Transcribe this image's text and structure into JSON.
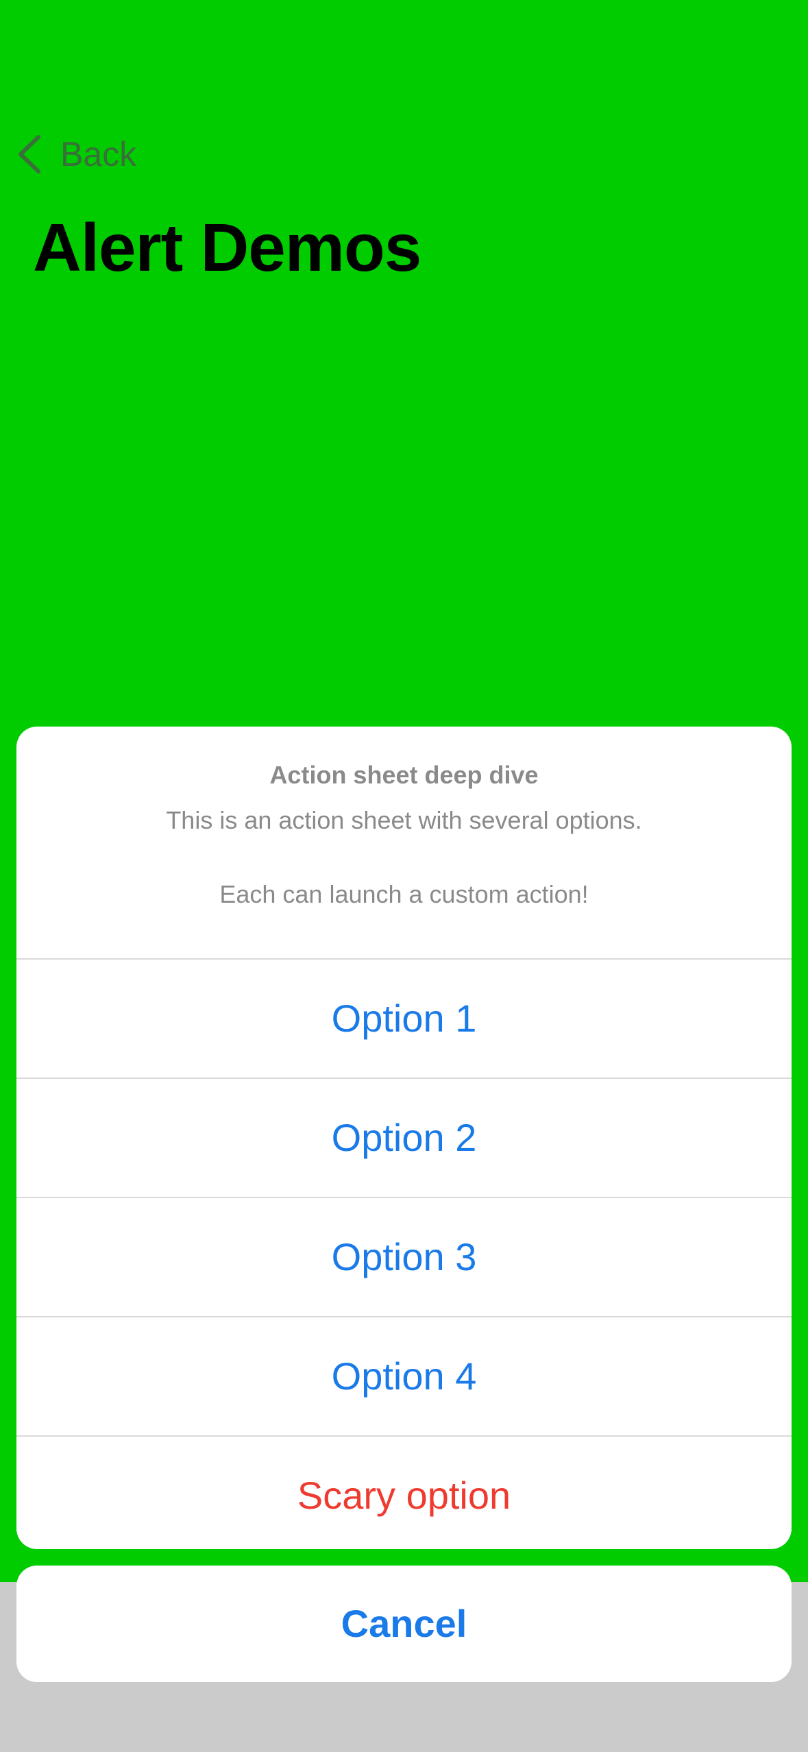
{
  "nav": {
    "back_label": "Back",
    "title": "Alert Demos"
  },
  "action_sheet": {
    "title": "Action sheet deep dive",
    "message_line1": "This is an action sheet with several options.",
    "message_line2": "Each can launch a custom action!",
    "options": [
      {
        "label": "Option 1",
        "style": "default"
      },
      {
        "label": "Option 2",
        "style": "default"
      },
      {
        "label": "Option 3",
        "style": "default"
      },
      {
        "label": "Option 4",
        "style": "default"
      },
      {
        "label": "Scary option",
        "style": "destructive"
      }
    ],
    "cancel_label": "Cancel"
  },
  "colors": {
    "background": "#00cc00",
    "accent": "#1a7ae8",
    "destructive": "#ee3b30",
    "dim_overlay": "#cbcbcb"
  },
  "icons": {
    "back": "chevron-left-icon"
  }
}
